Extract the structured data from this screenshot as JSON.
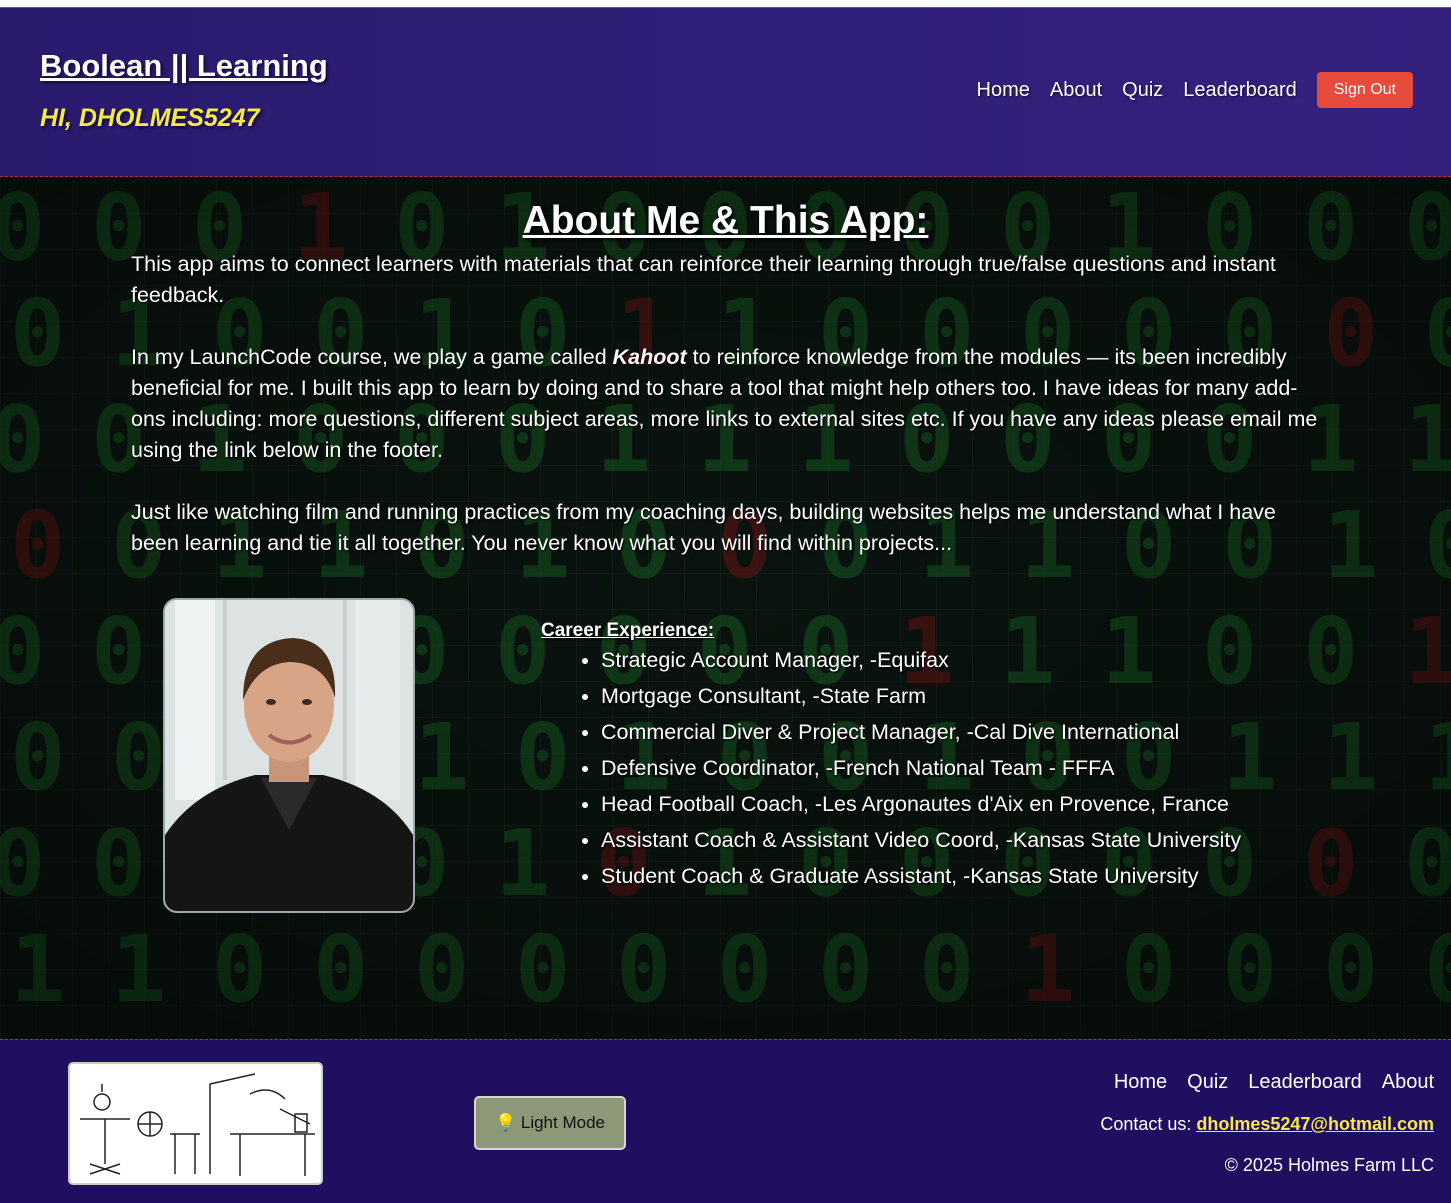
{
  "header": {
    "brand_title": "Boolean || Learning",
    "greeting": "HI, DHOLMES5247",
    "nav": [
      "Home",
      "About",
      "Quiz",
      "Leaderboard"
    ],
    "signout_label": "Sign Out"
  },
  "main": {
    "title": "About Me & This App:",
    "para1": "This app aims to connect learners with materials that can reinforce their learning through true/false questions and instant feedback.",
    "para2_before": "In my LaunchCode course, we play a game called ",
    "para2_emph": "Kahoot",
    "para2_after": " to reinforce knowledge from the modules — its been incredibly beneficial for me. I built this app to learn by doing and to share a tool that might help others too. I have ideas for many add-ons including: more questions, different subject areas, more links to external sites etc. If you have any ideas please email me using the link below in the footer.",
    "para3": "Just like watching film and running practices from my coaching days, building websites helps me understand what I have been learning and tie it all together. You never know what you will find within projects...",
    "career_heading": "Career Experience:",
    "career": [
      "Strategic Account Manager,   -Equifax",
      "Mortgage Consultant,   -State Farm",
      "Commercial Diver & Project Manager,   -Cal Dive International",
      "Defensive Coordinator,   -French National Team - FFFA",
      "Head Football Coach,   -Les Argonautes d'Aix en Provence, France",
      "Assistant Coach & Assistant Video Coord,   -Kansas State University",
      "Student Coach & Graduate Assistant,   -Kansas State University"
    ]
  },
  "footer": {
    "lightmode_icon": "lightbulb-icon",
    "lightmode_label": "💡 Light Mode",
    "links": [
      "Home",
      "Quiz",
      "Leaderboard",
      "About"
    ],
    "contact_label": "Contact us: ",
    "contact_email": "dholmes5247@hotmail.com",
    "copyright": "© 2025 Holmes Farm LLC"
  },
  "colors": {
    "header_bg": "#2f1f78",
    "footer_bg": "#200f60",
    "accent_yellow": "#f4e94a",
    "signout_red": "#e64b3c",
    "matrix_green": "#1f7a2c",
    "matrix_red": "#8a1a1a"
  }
}
